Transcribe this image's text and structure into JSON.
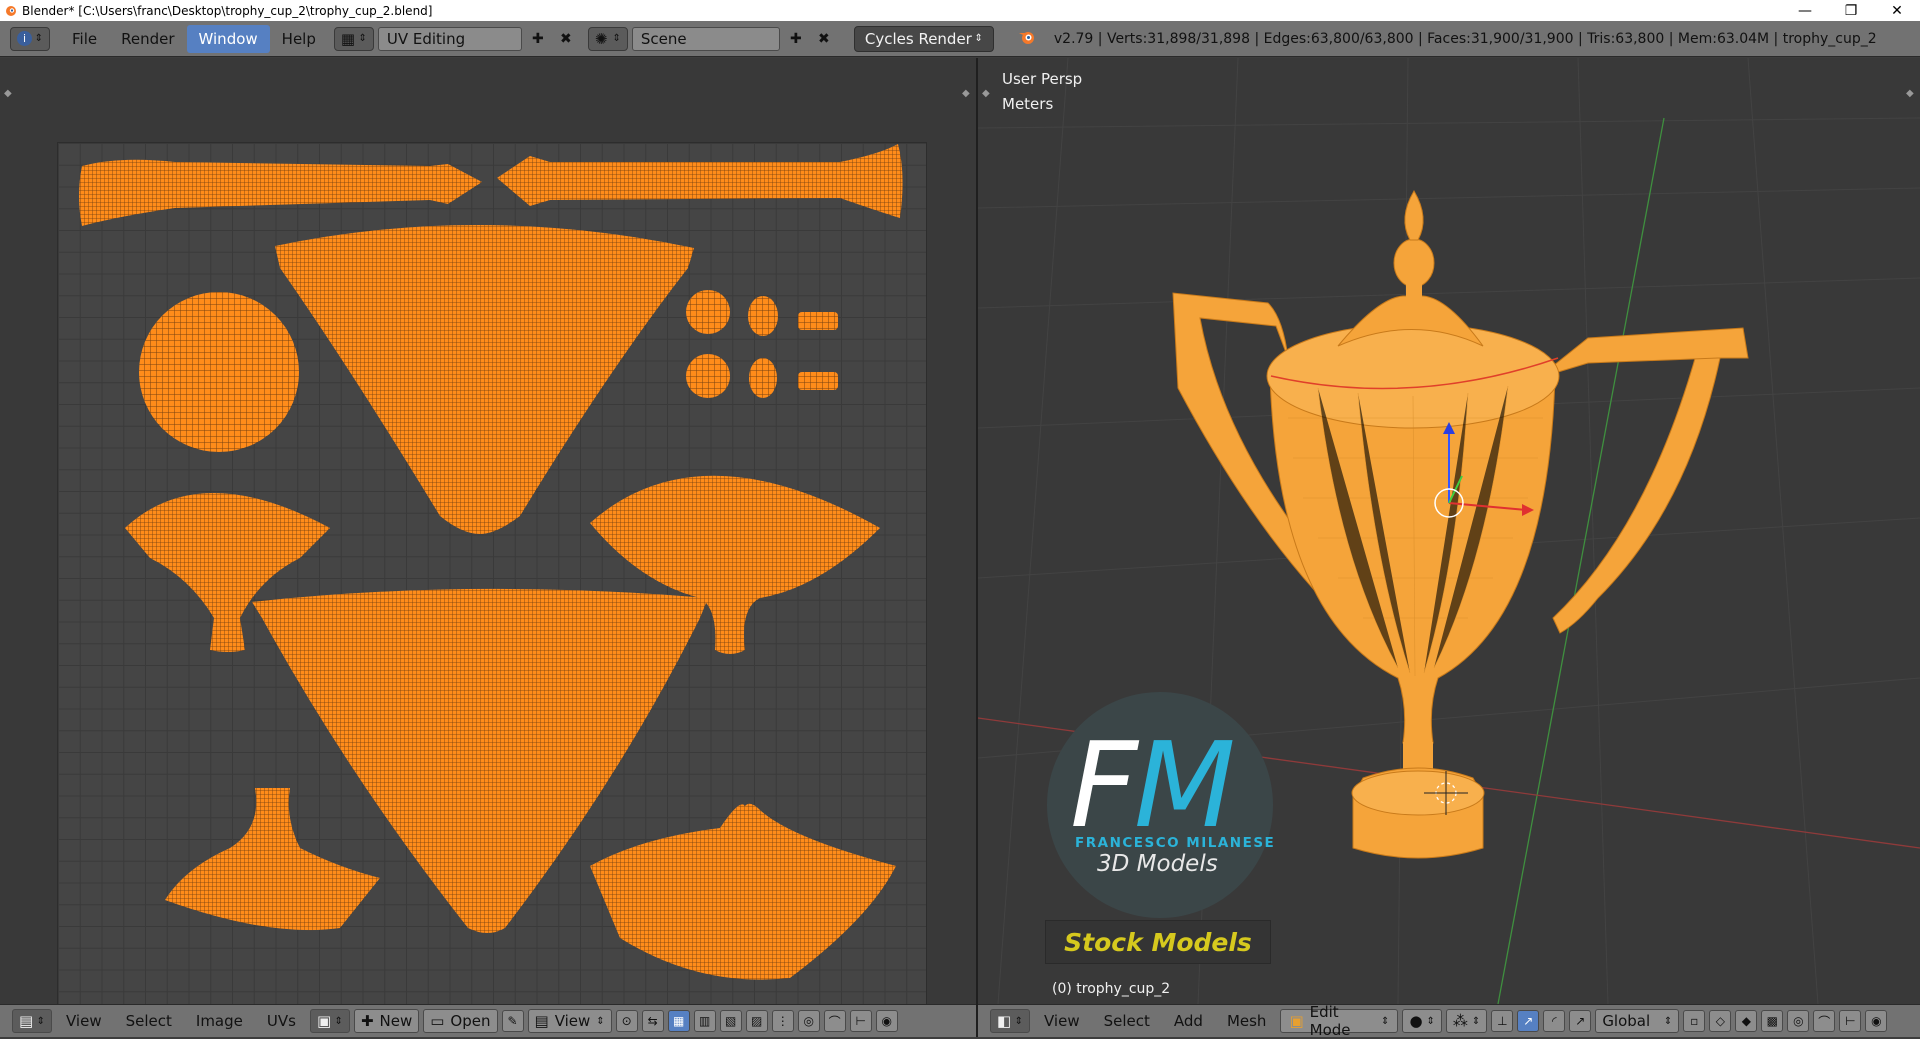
{
  "window": {
    "title": "Blender* [C:\\Users\\franc\\Desktop\\trophy_cup_2\\trophy_cup_2.blend]",
    "minimize": "—",
    "maximize": "❐",
    "close": "✕"
  },
  "info_header": {
    "menus": [
      "File",
      "Render",
      "Window",
      "Help"
    ],
    "active_menu": "Window",
    "screen_layout": "UV Editing",
    "scene": "Scene",
    "render_engine": "Cycles Render",
    "stats": "v2.79 | Verts:31,898/31,898 | Edges:63,800/63,800 | Faces:31,900/31,900 | Tris:63,800 | Mem:63.04M | trophy_cup_2"
  },
  "viewport": {
    "view_name": "User Persp",
    "units": "Meters",
    "object_label": "(0) trophy_cup_2"
  },
  "watermark": {
    "letters_f": "F",
    "letters_m": "M",
    "name": "FRANCESCO MILANESE",
    "subtitle": "3D Models",
    "stock": "Stock Models"
  },
  "uv_header": {
    "menus": [
      "View",
      "Select",
      "Image",
      "UVs"
    ],
    "new_label": "New",
    "open_label": "Open",
    "view_label": "View"
  },
  "view3d_header": {
    "menus": [
      "View",
      "Select",
      "Add",
      "Mesh"
    ],
    "mode": "Edit Mode",
    "orientation": "Global"
  },
  "colors": {
    "uv_orange": "#ff8c1a",
    "cup_orange": "#f5a43a",
    "selection_blue": "#5680c2",
    "stock_yellow": "#d6c91e",
    "fm_cyan": "#2bb3d9"
  }
}
